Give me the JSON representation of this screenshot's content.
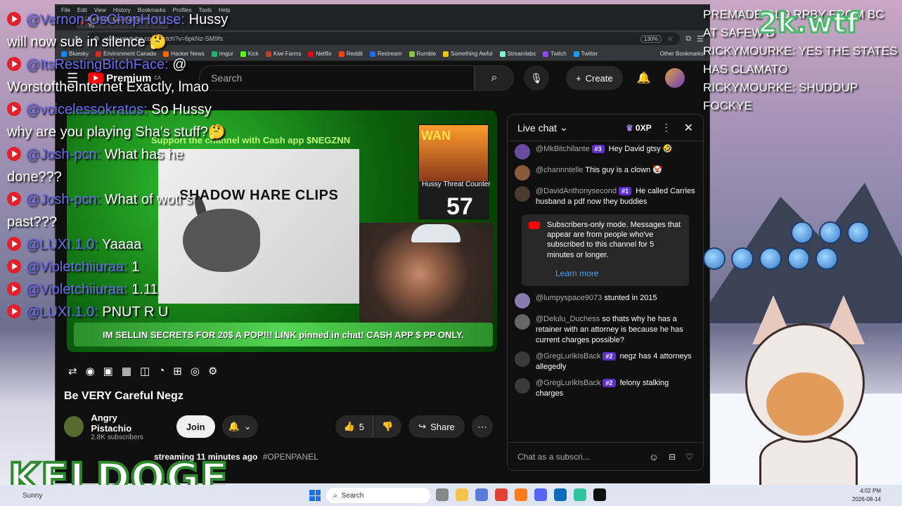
{
  "browser": {
    "menu": [
      "File",
      "Edit",
      "View",
      "History",
      "Bookmarks",
      "Profiles",
      "Tools",
      "Help"
    ],
    "tab_title": "Be VERY Careful Negz - Yo",
    "url": "www.youtube.com/watch?v=6pkNz-SM9fs",
    "zoom": "130%",
    "bookmarks": [
      "Bluesky",
      "Environment Canada",
      "Hacker News",
      "imgur",
      "Kick",
      "Kiwi Farms",
      "Netflix",
      "Reddit",
      "Restream",
      "Rumble",
      "Something Awful",
      "Streamlabs",
      "Twitch",
      "Twitter"
    ],
    "bookmark_colors": [
      "#1185fe",
      "#d52b1e",
      "#ff6600",
      "#1bb76e",
      "#53fc18",
      "#b5452d",
      "#e50914",
      "#ff4500",
      "#1e6cf0",
      "#85c742",
      "#f1c40f",
      "#80f5d2",
      "#9146ff",
      "#1d9bf0"
    ],
    "other_bookmarks": "Other Bookmarks"
  },
  "youtube": {
    "logo_text": "Premium",
    "country": "CA",
    "search_placeholder": "Search",
    "create_label": "Create",
    "video": {
      "support_banner": "Support the channel with Cash app $NEGZNN",
      "clip_title": "SHADOW HARE CLIPS",
      "wan_label": "WAN",
      "counter_label": "Hussy Threat Counter",
      "counter_value": "57",
      "ticker": "IM SELLIN SECRETS FOR 20$ A POP!!! LINK pinned in chat! CASH APP $ PP ONLY."
    },
    "title": "Be VERY Careful Negz",
    "channel_name": "Angry Pistachio",
    "subscribers": "2.8K subscribers",
    "join_label": "Join",
    "likes": "5",
    "share_label": "Share",
    "desc_line": "streaming 11 minutes ago",
    "desc_tag": "#OPENPANEL"
  },
  "livechat": {
    "header": "Live chat",
    "xp": "0XP",
    "messages": [
      {
        "user": "@MkBitchilante",
        "badge": "#3",
        "text": "Hey David gtsy 🤣",
        "color": "#6a4ba0"
      },
      {
        "user": "@channntelle",
        "badge": "",
        "text": "This guy is a clown 🤡",
        "color": "#8a5a3a"
      },
      {
        "user": "@DavidAnthonysecond",
        "badge": "#1",
        "text": "He called Carries husband a pdf now they buddies",
        "color": "#4a3a30"
      }
    ],
    "sub_mode_text": "Subscribers-only mode. Messages that appear are from people who've subscribed to this channel for 5 minutes or longer.",
    "learn_more": "Learn more",
    "messages2": [
      {
        "user": "@lumpyspace9073",
        "badge": "",
        "text": "stunted in 2015",
        "color": "#8a7ab0"
      },
      {
        "user": "@Delulu_Duchess",
        "badge": "",
        "text": "so thats why he has a retainer with an attorney is because he has current charges possible?",
        "color": "#666"
      },
      {
        "user": "@GregLurikIsBack",
        "badge": "#2",
        "text": "negz has 4 attorneys allegedly",
        "color": "#3a3a3a"
      },
      {
        "user": "@GregLurikIsBack",
        "badge": "#2",
        "text": "felony stalking charges",
        "color": "#3a3a3a"
      }
    ],
    "input_placeholder": "Chat as a subscri..."
  },
  "overlay_left": [
    {
      "user": "@Vernon-OsChopHouse:",
      "text": "Hussy will now sue in silence 🤔"
    },
    {
      "user": "@ItsRestingBitchFace:",
      "text": "@ WorstoftheInternet Exactly, lmao"
    },
    {
      "user": "@voicelessokratos:",
      "text": "So Hussy why are you playing Sha's stuff?🤔"
    },
    {
      "user": "@Josh-pcn:",
      "text": "What has he done???"
    },
    {
      "user": "@Josh-pcn:",
      "text": "What of woti s past???"
    },
    {
      "user": "@LUXI.1.0:",
      "text": "Yaaaa"
    },
    {
      "user": "@Violetchiiuraa:",
      "text": "1"
    },
    {
      "user": "@Violetchiiuraa:",
      "text": "1.11"
    },
    {
      "user": "@LUXI.1.0:",
      "text": "PNUT R U"
    }
  ],
  "overlay_right": [
    "PREMADE OLD RPBY FROM BC AT SAFEW D",
    "RickyMourke: YES THE STATES HAS CLAMATO",
    "RickyMourke: SHUDDUP FOCKYE"
  ],
  "logo_2k": "2k.wtf",
  "keldoge": "KELDOGE",
  "taskbar": {
    "weather": "Sunny",
    "search": "Search",
    "time": "4:02 PM",
    "date": "2026-08-14"
  }
}
